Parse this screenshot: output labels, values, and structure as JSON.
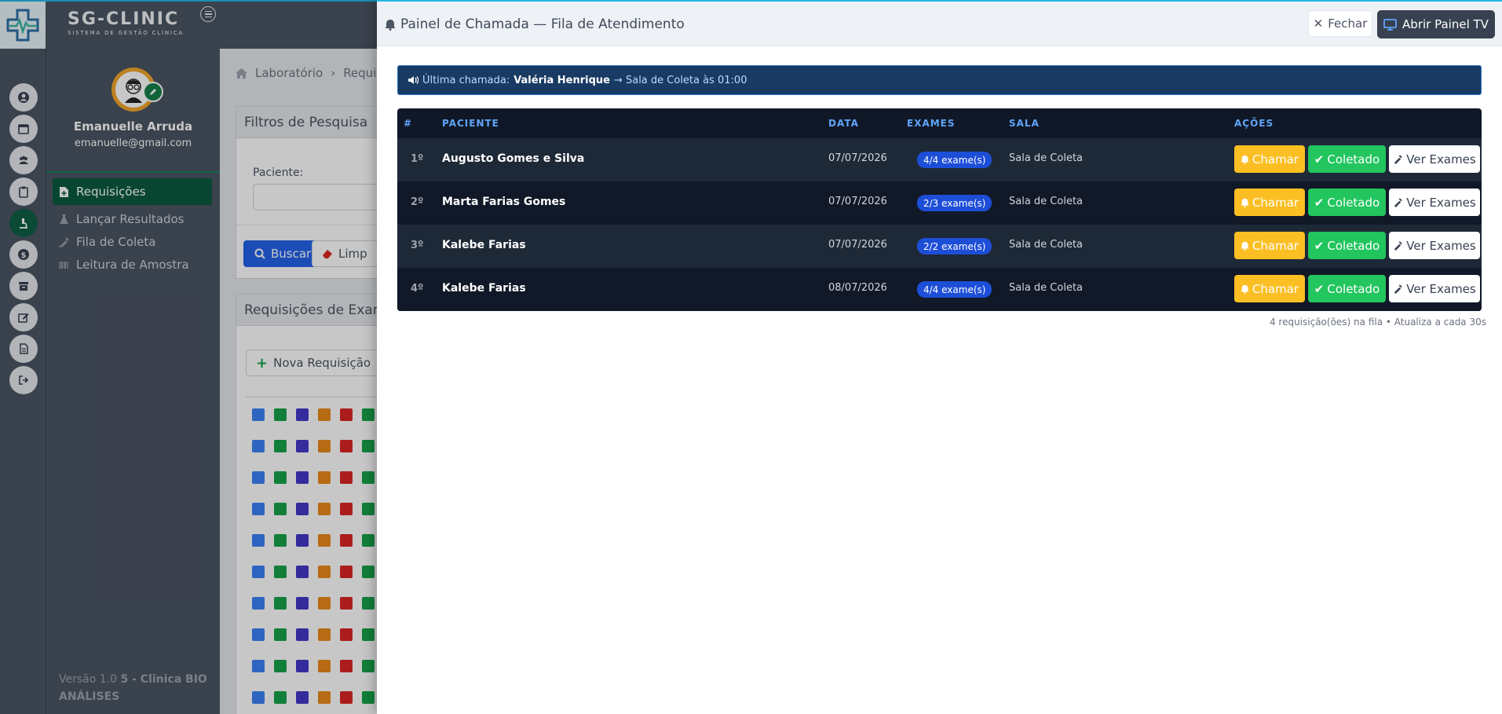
{
  "app": {
    "brand_name": "SG-CLINIC",
    "brand_subtitle": "SISTEMA DE GESTÃO CLÍNICA"
  },
  "user": {
    "name": "Emanuelle Arruda",
    "email": "emanuelle@gmail.com"
  },
  "sidebar": {
    "items": [
      {
        "label": "Requisições",
        "active": true
      },
      {
        "label": "Lançar Resultados",
        "active": false
      },
      {
        "label": "Fila de Coleta",
        "active": false
      },
      {
        "label": "Leitura de Amostra",
        "active": false
      }
    ],
    "version_prefix": "Versão 1.0 ",
    "version_clinic": "5 - Clinica BIO ANÁLISES"
  },
  "rail": {
    "icons": [
      "user-circle-icon",
      "calendar-icon",
      "users-icon",
      "clipboard-icon",
      "microscope-icon",
      "dollar-icon",
      "archive-icon",
      "edit-icon",
      "file-icon",
      "sign-out-icon"
    ]
  },
  "background": {
    "breadcrumb": [
      "Laboratório",
      "Requis"
    ],
    "filters_title": "Filtros de Pesquisa",
    "patient_label": "Paciente:",
    "search_button": "Buscar",
    "clear_button": "Limp",
    "requests_title": "Requisições de Exame",
    "new_request_button": "Nova Requisição"
  },
  "panel": {
    "title": "Painel de Chamada — Fila de Atendimento",
    "close_label": "Fechar",
    "tv_label": "Abrir Painel TV",
    "last_call_prefix": "Última chamada: ",
    "last_call_name": "Valéria Henrique",
    "last_call_suffix": " → Sala de Coleta às 01:00",
    "columns": [
      "#",
      "PACIENTE",
      "DATA",
      "EXAMES",
      "SALA",
      "AÇÕES"
    ],
    "rows": [
      {
        "pos": "1º",
        "patient": "Augusto Gomes e Silva",
        "date": "07/07/2026",
        "exams": "4/4 exame(s)",
        "room": "Sala de Coleta"
      },
      {
        "pos": "2º",
        "patient": "Marta Farias Gomes",
        "date": "07/07/2026",
        "exams": "2/3 exame(s)",
        "room": "Sala de Coleta"
      },
      {
        "pos": "3º",
        "patient": "Kalebe Farias",
        "date": "07/07/2026",
        "exams": "2/2 exame(s)",
        "room": "Sala de Coleta"
      },
      {
        "pos": "4º",
        "patient": "Kalebe Farias",
        "date": "08/07/2026",
        "exams": "4/4 exame(s)",
        "room": "Sala de Coleta"
      }
    ],
    "call_label": "Chamar",
    "done_label": "Coletado",
    "view_label": "Ver Exames",
    "footer": "4 requisição(ões) na fila • Atualiza a cada 30s"
  },
  "colors": {
    "accent": "#22b8e8",
    "sidebar_bg": "#4b5563",
    "active_green": "#0b5a3f",
    "table_bg": "#101827",
    "call_button": "#fbbf24",
    "done_button": "#22c55e",
    "exam_badge": "#1d4ed8"
  }
}
